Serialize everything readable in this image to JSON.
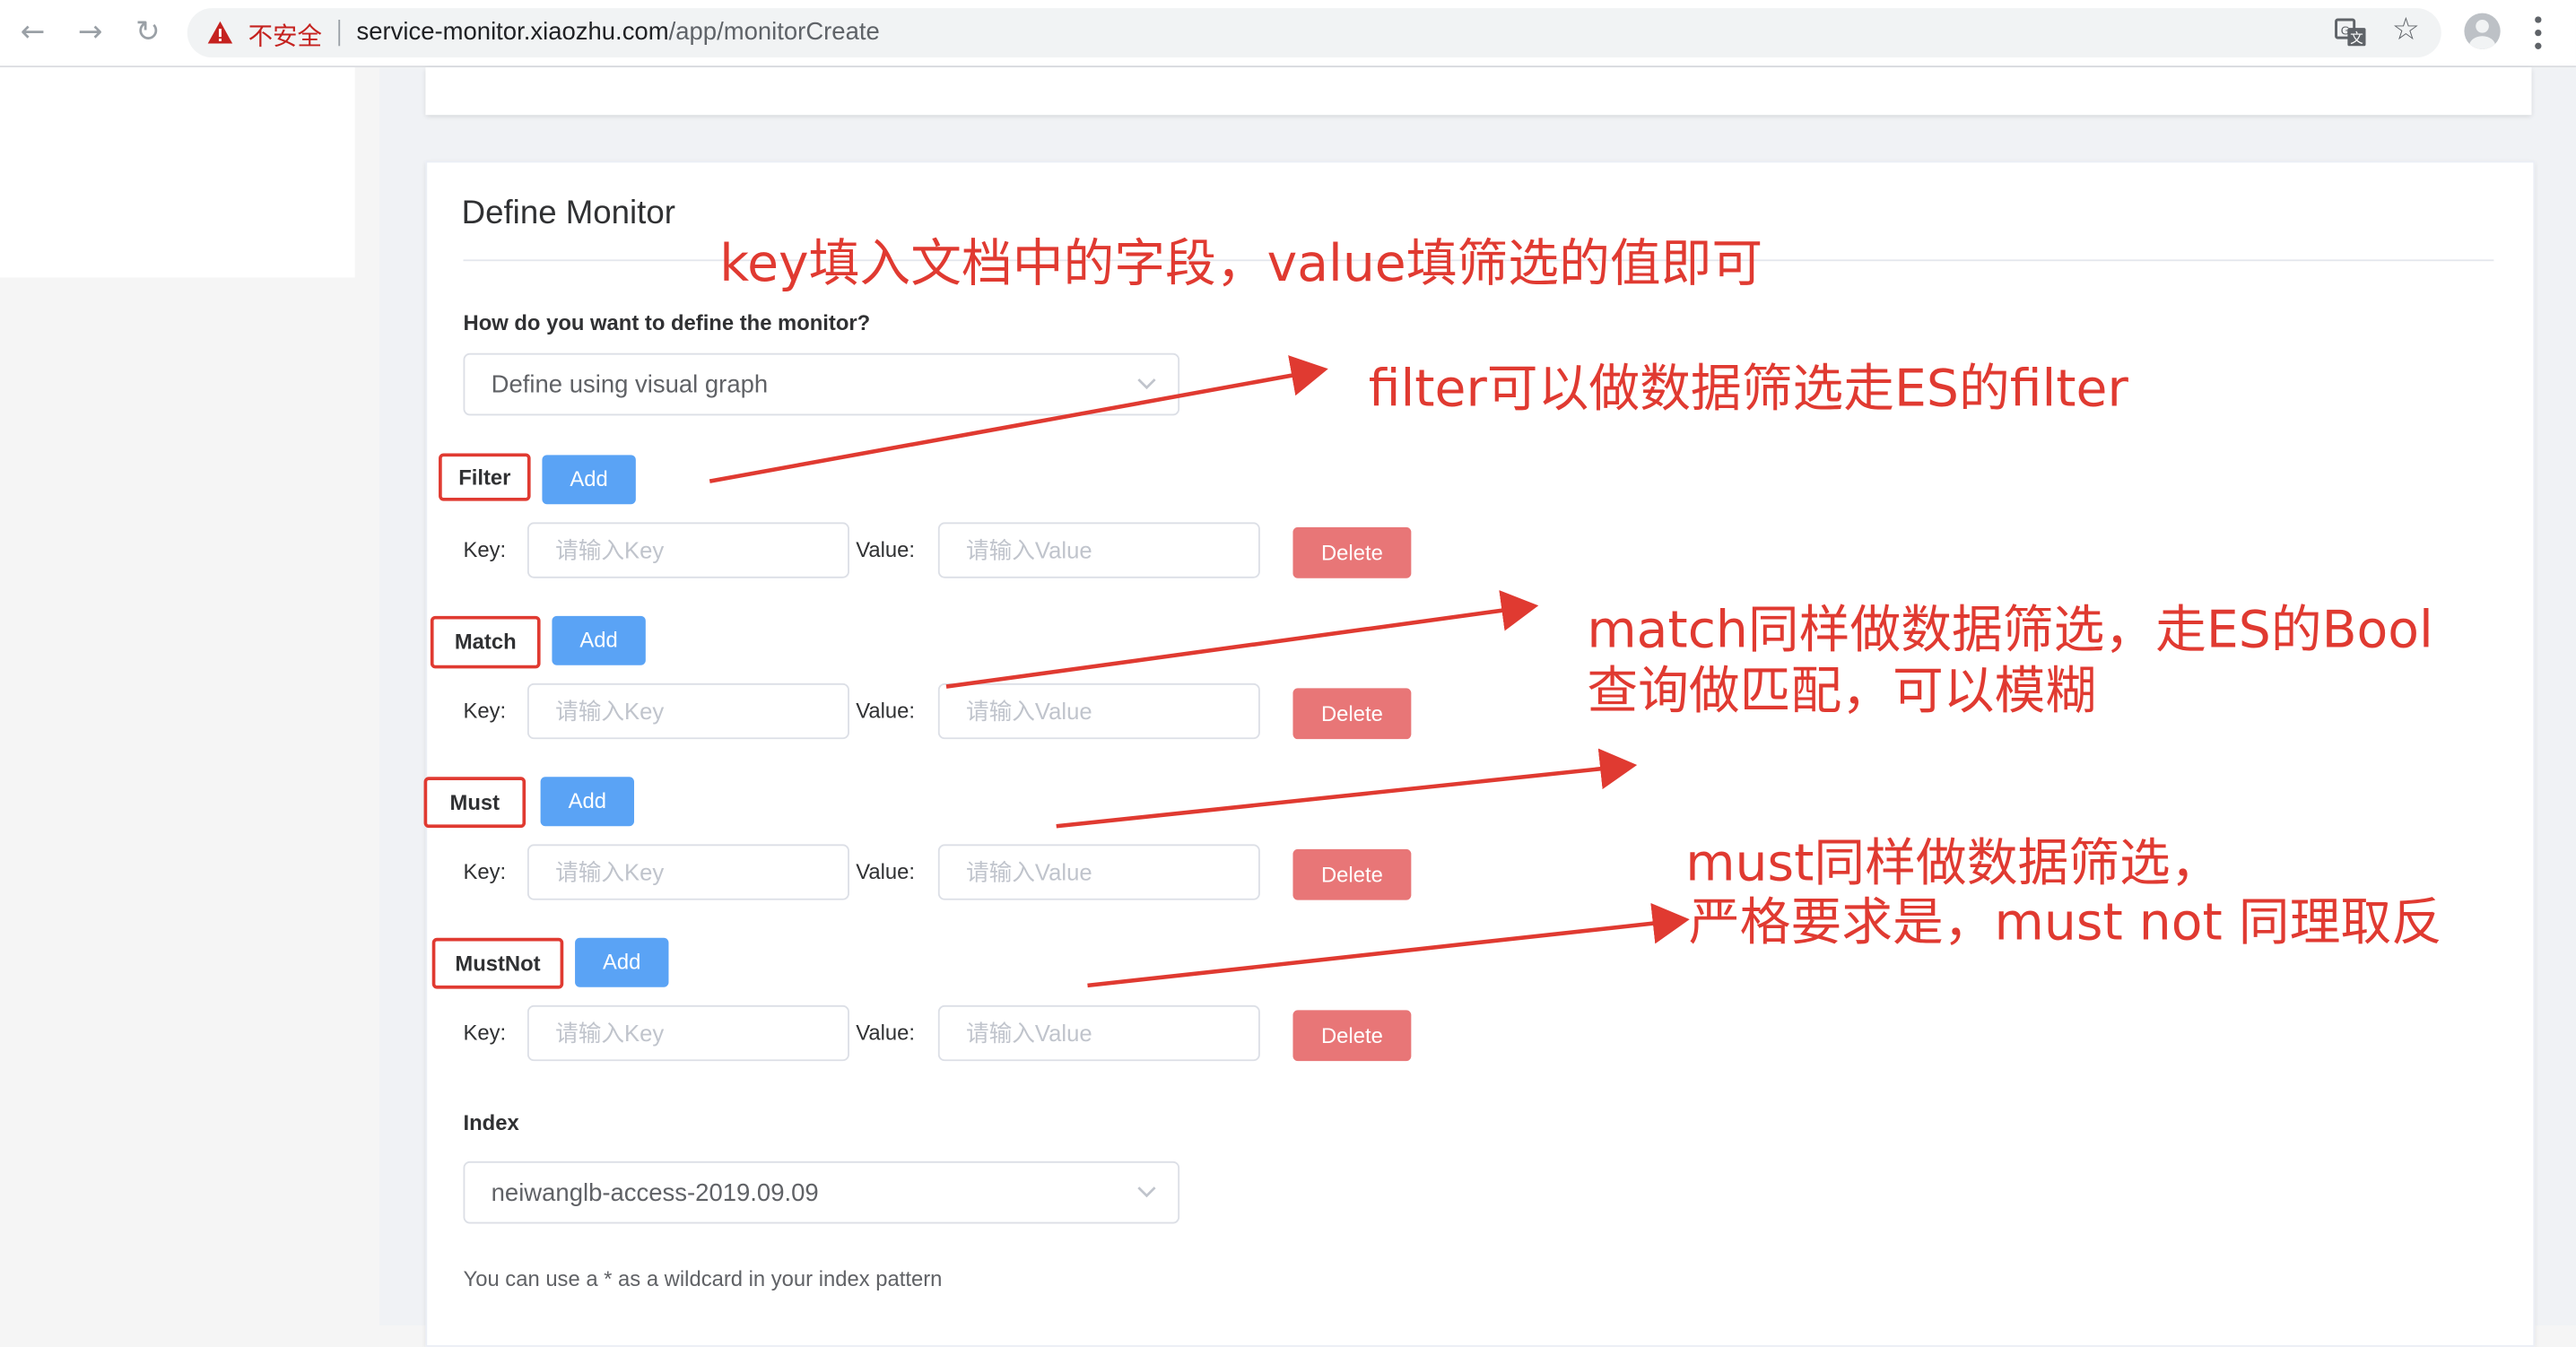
{
  "browser": {
    "insecure_label": "不安全",
    "url_host": "service-monitor.xiaozhu.com",
    "url_path": "/app/monitorCreate"
  },
  "page": {
    "section_title": "Define Monitor",
    "define_question": "How do you want to define the monitor?",
    "define_method": "Define using visual graph",
    "key_label": "Key:",
    "value_label": "Value:",
    "key_placeholder": "请输入Key",
    "value_placeholder": "请输入Value",
    "add_label": "Add",
    "delete_label": "Delete",
    "sections": [
      {
        "label": "Filter"
      },
      {
        "label": "Match"
      },
      {
        "label": "Must"
      },
      {
        "label": "MustNot"
      }
    ],
    "index_label": "Index",
    "index_value": "neiwanglb-access-2019.09.09",
    "index_hint": "You can use a * as a wildcard in your index pattern"
  },
  "annotations": {
    "top": "key填入文档中的字段，value填筛选的值即可",
    "filter": "filter可以做数据筛选走ES的filter",
    "match_line1": "match同样做数据筛选，走ES的Bool",
    "match_line2": "查询做匹配，可以模糊",
    "must_line1": "must同样做数据筛选，",
    "must_line2": "严格要求是，must not 同理取反",
    "color": "#e03a31"
  }
}
